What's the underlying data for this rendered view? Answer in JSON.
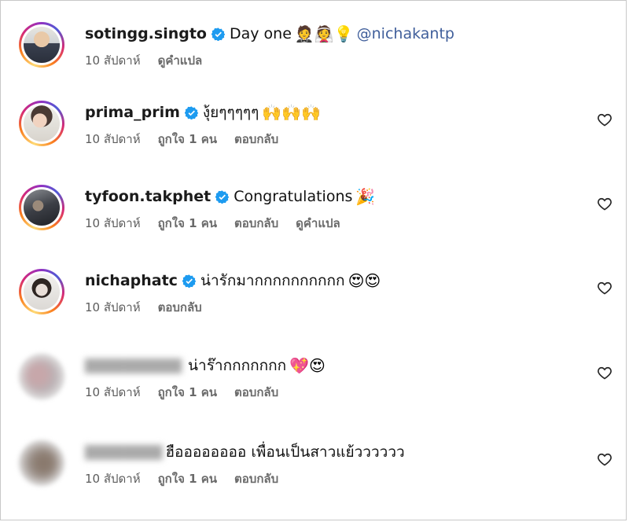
{
  "comments": [
    {
      "username": "sotingg.singto",
      "verified": true,
      "text": "Day one",
      "emojis": "🤵👰💡",
      "mention": "@nichakantp",
      "time": "10 สัปดาห์",
      "actions": [
        "ดูคำแปล"
      ],
      "has_like": false
    },
    {
      "username": "prima_prim",
      "verified": true,
      "text": "งุ้ยๆๆๆๆๆ",
      "emojis": "🙌🙌🙌",
      "time": "10 สัปดาห์",
      "likes": "ถูกใจ 1 คน",
      "actions": [
        "ตอบกลับ"
      ],
      "has_like": true
    },
    {
      "username": "tyfoon.takphet",
      "verified": true,
      "text": "Congratulations",
      "emojis": "🎉",
      "time": "10 สัปดาห์",
      "likes": "ถูกใจ 1 คน",
      "actions": [
        "ตอบกลับ",
        "ดูคำแปล"
      ],
      "has_like": true
    },
    {
      "username": "nichaphatc",
      "verified": true,
      "text": "น่ารักมากกกกกกกกกก",
      "emojis": "😍😍",
      "time": "10 สัปดาห์",
      "actions": [
        "ตอบกลับ"
      ],
      "has_like": true
    },
    {
      "username": "",
      "verified": false,
      "text": "น่าร๊ากกกกกกก",
      "emojis": "💖😍",
      "time": "10 สัปดาห์",
      "likes": "ถูกใจ 1 คน",
      "actions": [
        "ตอบกลับ"
      ],
      "has_like": true
    },
    {
      "username": "",
      "verified": false,
      "text": "ฮืออออออออ เพื่อนเป็นสาวแย้วววววว",
      "emojis": "",
      "time": "10 สัปดาห์",
      "likes": "ถูกใจ 1 คน",
      "actions": [
        "ตอบกลับ"
      ],
      "has_like": true
    }
  ],
  "icons": {
    "verified": "verified-badge-icon",
    "like": "heart-outline-icon"
  },
  "colors": {
    "verified_blue": "#1d9bf0",
    "mention": "#405f9b",
    "meta_text": "#5c5c5c"
  }
}
